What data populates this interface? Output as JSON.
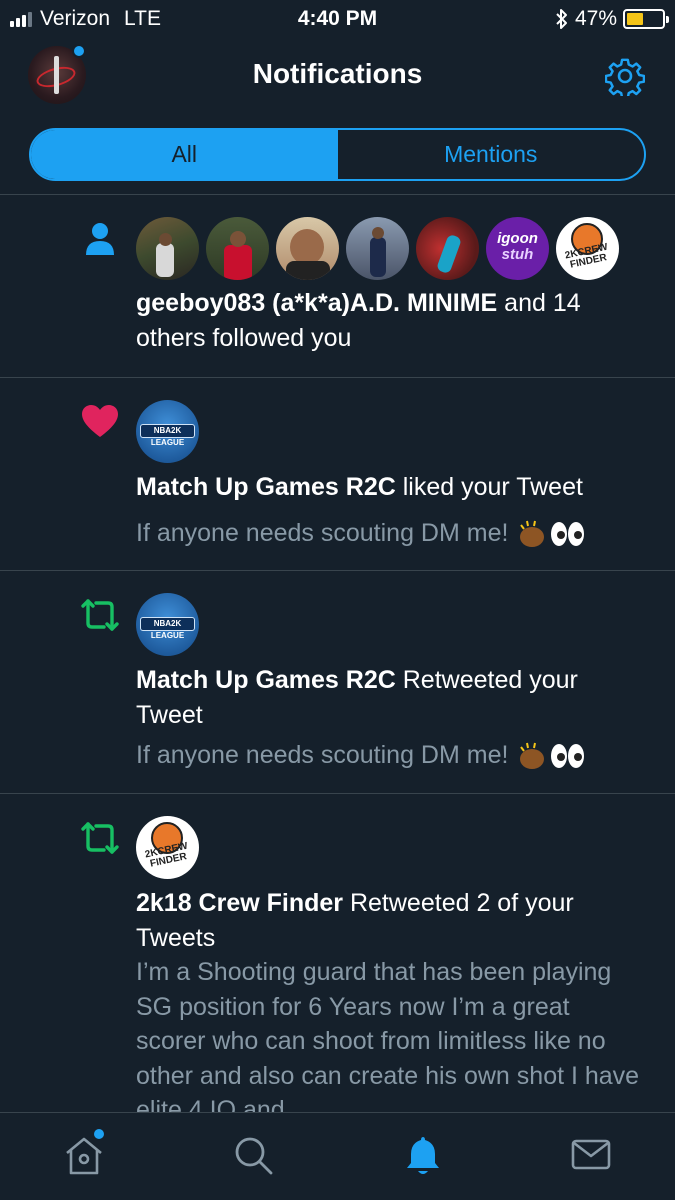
{
  "status": {
    "carrier": "Verizon",
    "network": "LTE",
    "time": "4:40 PM",
    "battery": "47%",
    "battery_level": 0.47
  },
  "header": {
    "title": "Notifications",
    "avatar_icon": "profile-avatar",
    "settings_icon": "gear-icon"
  },
  "tabs": {
    "all_label": "All",
    "mentions_label": "Mentions",
    "active": "All"
  },
  "notifications": [
    {
      "type": "follow",
      "icon": "person-icon",
      "avatar_count": 7,
      "avatar_texts": {
        "igoon_line1": "igoon",
        "igoon_line2": "stuh"
      },
      "actors": "geeboy083 (a*k*a)A.D. MINIME",
      "action": " and 14 others followed you"
    },
    {
      "type": "like",
      "icon": "heart-icon",
      "actor": "Match Up Games R2C",
      "action": " liked your Tweet",
      "tweet": "If anyone needs scouting DM me!",
      "logo_text": "NBA2K LEAGUE"
    },
    {
      "type": "retweet",
      "icon": "retweet-icon",
      "actor": "Match Up Games R2C",
      "action": " Retweeted your Tweet",
      "tweet": "If anyone needs scouting DM me!",
      "logo_text": "NBA2K LEAGUE"
    },
    {
      "type": "retweet",
      "icon": "retweet-icon",
      "actor": "2k18 Crew Finder",
      "action": " Retweeted 2 of your Tweets",
      "tweet": "I’m a Shooting guard that has been playing SG position for 6 Years now I’m a great scorer who can shoot from limitless like no other and also can create his own shot I have elite 4 IQ and",
      "logo_text": "2KCREW FINDER"
    }
  ],
  "tabbar": {
    "home_icon": "home-icon",
    "search_icon": "search-icon",
    "notifications_icon": "bell-icon",
    "messages_icon": "mail-icon"
  },
  "colors": {
    "background": "#15202b",
    "accent": "#1da1f2",
    "like": "#e0245e",
    "retweet": "#17bf63",
    "secondary_text": "#8899a6",
    "divider": "#38444d"
  }
}
